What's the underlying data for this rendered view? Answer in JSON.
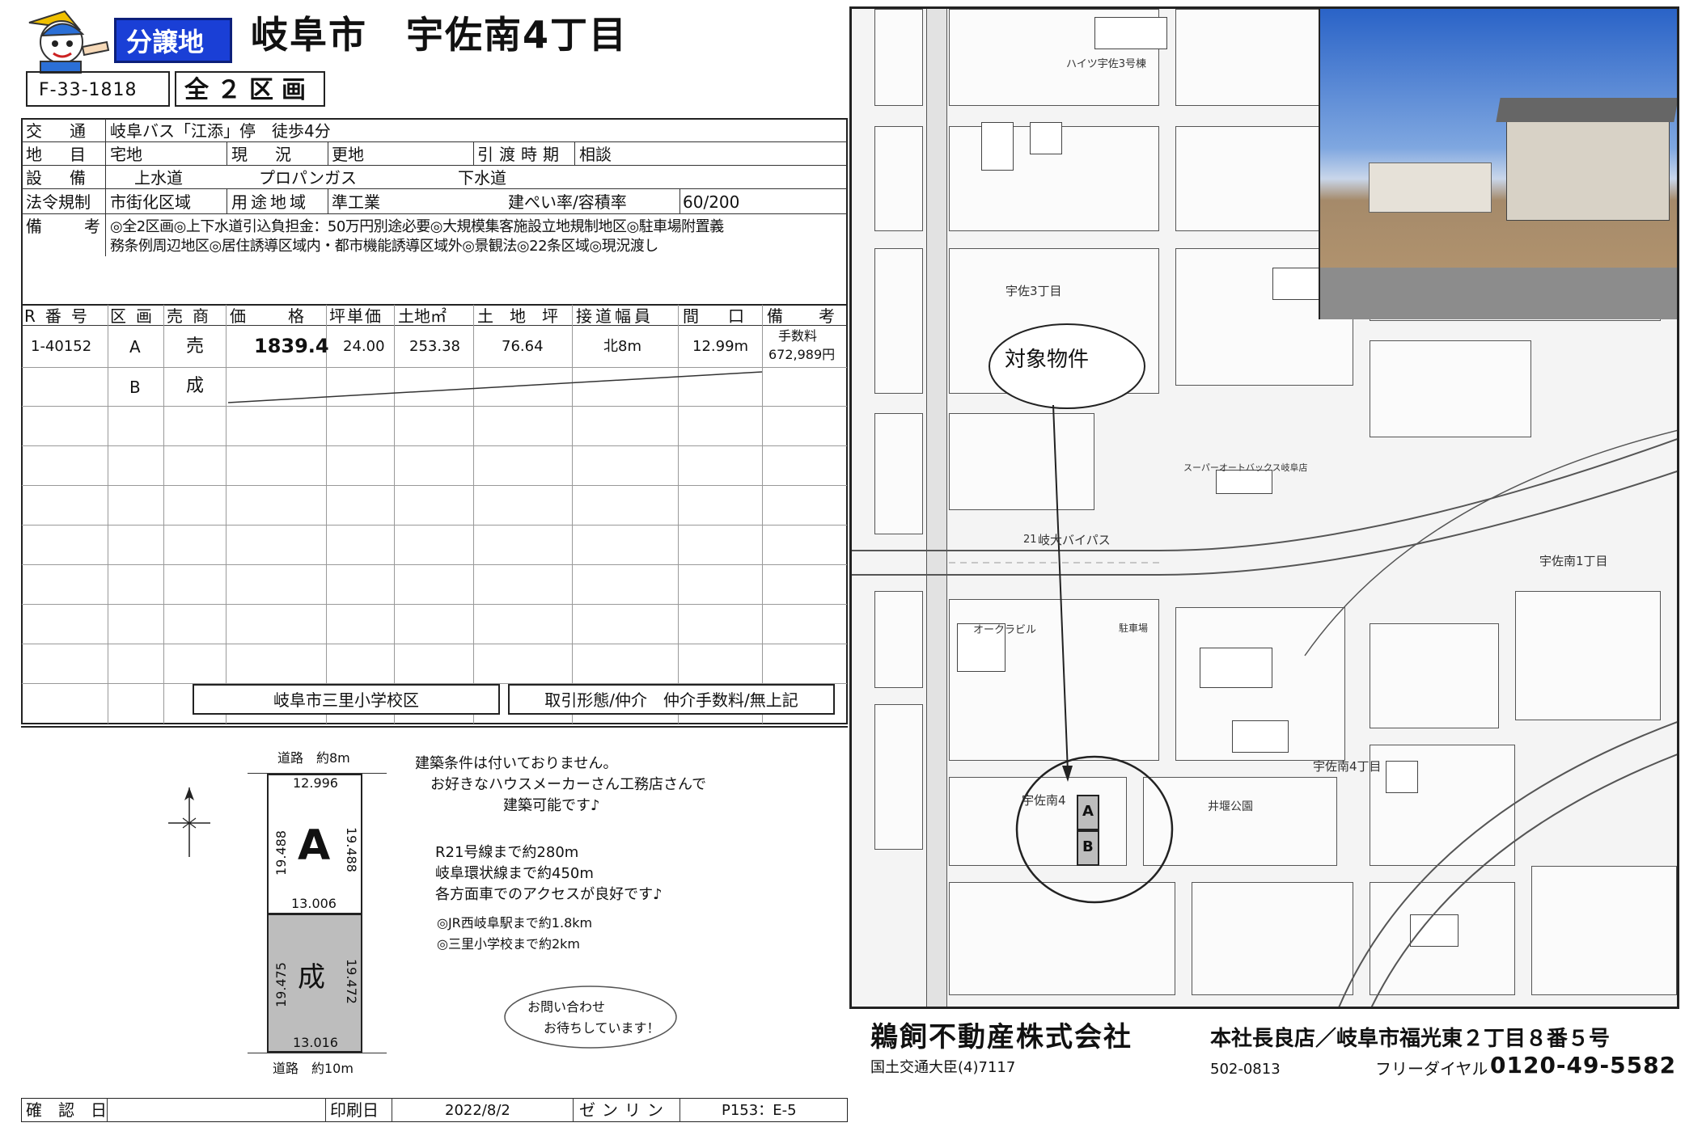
{
  "header": {
    "badge": "分譲地",
    "title": "岐阜市　宇佐南4丁目",
    "code": "F-33-1818",
    "lots": "全２区画"
  },
  "info": {
    "rows": [
      {
        "label": "交　通",
        "value": "岐阜バス「江添」停　徒歩4分"
      },
      {
        "label": "地　目",
        "value": "宅地"
      },
      {
        "label": "設　備",
        "value": ""
      },
      {
        "label": "法令規制",
        "value": "市街化区域"
      },
      {
        "label": "備　考",
        "value": "◎全2区画◎上下水道引込負担金：50万円別途必要◎大規模集客施設立地規制地区◎駐車場附置義"
      }
    ],
    "genkyo_label": "現　況",
    "genkyo_value": "更地",
    "hikiwatashi_label": "引渡時期",
    "hikiwatashi_value": "相談",
    "water": "上水道",
    "gas": "プロパンガス",
    "sewer": "下水道",
    "youto_label": "用途地域",
    "youto_value": "準工業",
    "ratio_label": "建ぺい率/容積率",
    "ratio_value": "60/200",
    "remarks2": "務条例周辺地区◎居住誘導区域内・都市機能誘導区域外◎景観法◎22条区域◎現況渡し"
  },
  "table": {
    "headers": [
      "R番号",
      "区画",
      "売商",
      "価　　格",
      "坪単価",
      "土地㎡",
      "土　地　坪",
      "接道幅員",
      "間　口",
      "備　考"
    ],
    "rows": [
      {
        "r": "1-40152",
        "ku": "A",
        "status": "売",
        "price": "1839.4",
        "tsubo_price": "24.00",
        "m2": "253.38",
        "tsubo": "76.64",
        "road": "北8m",
        "frontage": "12.99m",
        "note1": "手数料",
        "note2": "672,989円"
      },
      {
        "r": "",
        "ku": "B",
        "status": "成",
        "price": "",
        "tsubo_price": "",
        "m2": "",
        "tsubo": "",
        "road": "",
        "frontage": "",
        "note1": "",
        "note2": ""
      }
    ],
    "school": "岐阜市三里小学校区",
    "deal": "取引形態/仲介　仲介手数料/無上記"
  },
  "plan": {
    "road_top": "道路　約8m",
    "road_bottom": "道路　約10m",
    "lot_a": "A",
    "lot_b": "成",
    "a_top": "12.996",
    "a_bottom": "13.006",
    "a_left": "19.488",
    "a_right": "19.488",
    "b_bottom": "13.016",
    "b_left": "19.475",
    "b_right": "19.472",
    "notes": [
      "建築条件は付いておりません。",
      "お好きなハウスメーカーさん工務店さんで",
      "建築可能です♪"
    ],
    "access": [
      "R21号線まで約280m",
      "岐阜環状線まで約450m",
      "各方面車でのアクセスが良好です♪"
    ],
    "near": [
      "◎JR西岐阜駅まで約1.8km",
      "◎三里小学校まで約2km"
    ],
    "bubble": [
      "お問い合わせ",
      "お待ちしています！"
    ]
  },
  "footer": {
    "kakunin": "確　認　日",
    "insatsu": "印刷日",
    "date": "2022/8/2",
    "zenrin": "ゼンリン",
    "page": "P153：E-5"
  },
  "company": {
    "name": "鵜飼不動産株式会社",
    "license": "国土交通大臣(4)7117",
    "branch": "本社長良店／岐阜市福光東２丁目８番５号",
    "zip": "502-0813",
    "phone_label": "フリーダイヤル",
    "phone": "0120-49-5582"
  },
  "map": {
    "target": "対象物件",
    "labels": [
      "ハイツ宇佐3号棟",
      "宇佐3丁目",
      "宇佐南1丁目",
      "宇佐南4",
      "宇佐南4丁目",
      "岐大バイパス",
      "21",
      "井堰公園",
      "スーパーオートバックス岐阜店",
      "オークラビル",
      "駐車場"
    ],
    "lot_a": "A",
    "lot_b": "B"
  },
  "colors": {
    "badge_bg": "#1a3fd6",
    "badge_text": "#ffffff",
    "lot_b_fill": "#bdbdbd"
  }
}
